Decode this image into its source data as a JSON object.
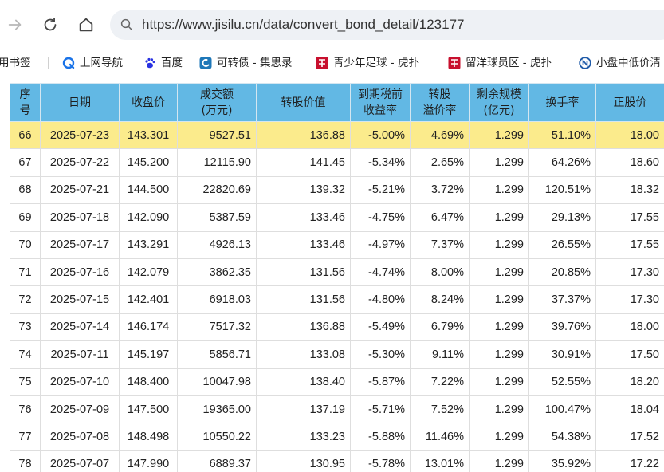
{
  "browser": {
    "url": "https://www.jisilu.cn/data/convert_bond_detail/123177"
  },
  "bookmarks": [
    {
      "label": "用书签",
      "icon": "none"
    },
    {
      "label": "上网导航",
      "icon": "q-logo-icon"
    },
    {
      "label": "百度",
      "icon": "baidu-paw-icon"
    },
    {
      "label": "可转债 - 集思录",
      "icon": "jisilu-logo-icon"
    },
    {
      "label": "青少年足球 - 虎扑",
      "icon": "hupu-logo-icon"
    },
    {
      "label": "留洋球员区 - 虎扑",
      "icon": "hupu-logo-icon"
    },
    {
      "label": "小盘中低价清",
      "icon": "jisilu-n-icon"
    }
  ],
  "colors": {
    "header_bg": "#62b8e4",
    "highlight_row": "#fbeb8c"
  },
  "table": {
    "headers": [
      "序号",
      "日期",
      "收盘价",
      "成交额(万元)",
      "转股价值",
      "到期税前收益率",
      "转股溢价率",
      "剩余规模(亿元)",
      "换手率",
      "正股价"
    ],
    "header_lines": [
      [
        "序",
        "号"
      ],
      [
        "日期"
      ],
      [
        "收盘价"
      ],
      [
        "成交额",
        "(万元)"
      ],
      [
        "转股价值"
      ],
      [
        "到期税前",
        "收益率"
      ],
      [
        "转股",
        "溢价率"
      ],
      [
        "剩余规模",
        "(亿元)"
      ],
      [
        "换手率"
      ],
      [
        "正股价"
      ]
    ],
    "rows": [
      [
        "66",
        "2025-07-23",
        "143.301",
        "9527.51",
        "136.88",
        "-5.00%",
        "4.69%",
        "1.299",
        "51.10%",
        "18.00"
      ],
      [
        "67",
        "2025-07-22",
        "145.200",
        "12115.90",
        "141.45",
        "-5.34%",
        "2.65%",
        "1.299",
        "64.26%",
        "18.60"
      ],
      [
        "68",
        "2025-07-21",
        "144.500",
        "22820.69",
        "139.32",
        "-5.21%",
        "3.72%",
        "1.299",
        "120.51%",
        "18.32"
      ],
      [
        "69",
        "2025-07-18",
        "142.090",
        "5387.59",
        "133.46",
        "-4.75%",
        "6.47%",
        "1.299",
        "29.13%",
        "17.55"
      ],
      [
        "70",
        "2025-07-17",
        "143.291",
        "4926.13",
        "133.46",
        "-4.97%",
        "7.37%",
        "1.299",
        "26.55%",
        "17.55"
      ],
      [
        "71",
        "2025-07-16",
        "142.079",
        "3862.35",
        "131.56",
        "-4.74%",
        "8.00%",
        "1.299",
        "20.85%",
        "17.30"
      ],
      [
        "72",
        "2025-07-15",
        "142.401",
        "6918.03",
        "131.56",
        "-4.80%",
        "8.24%",
        "1.299",
        "37.37%",
        "17.30"
      ],
      [
        "73",
        "2025-07-14",
        "146.174",
        "7517.32",
        "136.88",
        "-5.49%",
        "6.79%",
        "1.299",
        "39.76%",
        "18.00"
      ],
      [
        "74",
        "2025-07-11",
        "145.197",
        "5856.71",
        "133.08",
        "-5.30%",
        "9.11%",
        "1.299",
        "30.91%",
        "17.50"
      ],
      [
        "75",
        "2025-07-10",
        "148.400",
        "10047.98",
        "138.40",
        "-5.87%",
        "7.22%",
        "1.299",
        "52.55%",
        "18.20"
      ],
      [
        "76",
        "2025-07-09",
        "147.500",
        "19365.00",
        "137.19",
        "-5.71%",
        "7.52%",
        "1.299",
        "100.47%",
        "18.04"
      ],
      [
        "77",
        "2025-07-08",
        "148.498",
        "10550.22",
        "133.23",
        "-5.88%",
        "11.46%",
        "1.299",
        "54.38%",
        "17.52"
      ],
      [
        "78",
        "2025-07-07",
        "147.990",
        "6889.37",
        "130.95",
        "-5.78%",
        "13.01%",
        "1.299",
        "35.92%",
        "17.22"
      ]
    ],
    "highlight_row_index": 0
  }
}
